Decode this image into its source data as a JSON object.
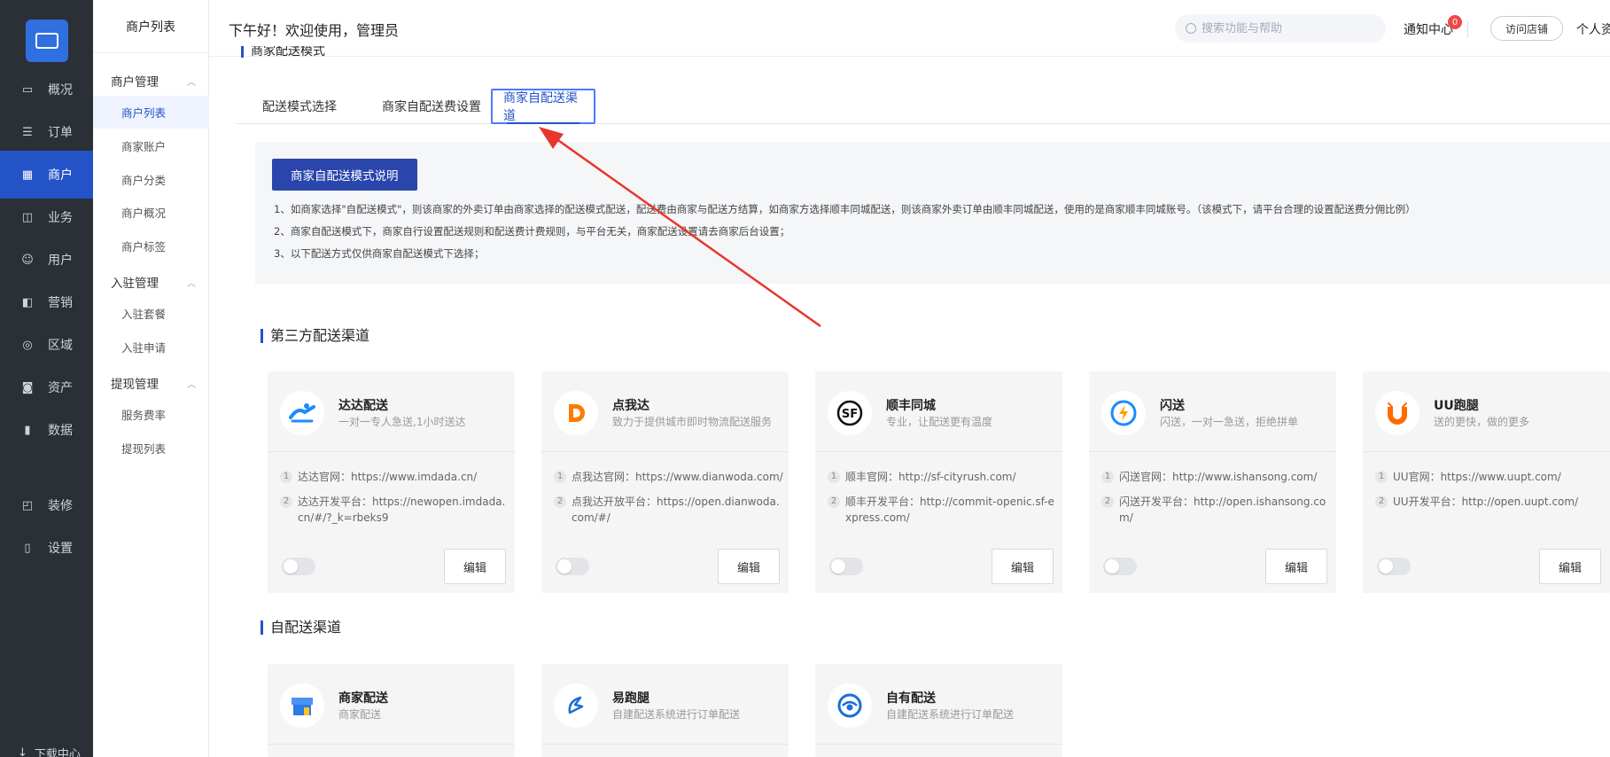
{
  "nav": {
    "items": [
      {
        "label": "概况",
        "icon": "dashboard-icon"
      },
      {
        "label": "订单",
        "icon": "order-icon"
      },
      {
        "label": "商户",
        "icon": "merchant-icon"
      },
      {
        "label": "业务",
        "icon": "business-icon"
      },
      {
        "label": "用户",
        "icon": "user-icon"
      },
      {
        "label": "营销",
        "icon": "marketing-icon"
      },
      {
        "label": "区域",
        "icon": "region-icon"
      },
      {
        "label": "资产",
        "icon": "asset-icon"
      },
      {
        "label": "数据",
        "icon": "data-icon"
      },
      {
        "label": "装修",
        "icon": "decorate-icon"
      },
      {
        "label": "设置",
        "icon": "settings-icon"
      }
    ],
    "footer": "下载中心",
    "active_color": "#2353c6"
  },
  "subnav": {
    "title": "商户列表",
    "groups": [
      {
        "label": "商户管理",
        "items": [
          "商户列表",
          "商家账户",
          "商户分类",
          "商户概况",
          "商户标签"
        ]
      },
      {
        "label": "入驻管理",
        "items": [
          "入驻套餐",
          "入驻申请"
        ]
      },
      {
        "label": "提现管理",
        "items": [
          "服务费率",
          "提现列表"
        ]
      }
    ]
  },
  "header": {
    "greeting": "下午好！欢迎使用，管理员",
    "search_placeholder": "搜索功能与帮助",
    "notice": "通知中心",
    "notice_count": "0",
    "visit_store": "访问店铺",
    "personal": "个人资"
  },
  "page": {
    "crumb": "商家配送模式",
    "tabs": [
      "配送模式选择",
      "商家自配送费设置",
      "商家自配送渠道"
    ],
    "info": {
      "button": "商家自配送模式说明",
      "lines": [
        "1、如商家选择\"自配送模式\"，则该商家的外卖订单由商家选择的配送模式配送，配送费由商家与配送方结算，如商家方选择顺丰同城配送，则该商家外卖订单由顺丰同城配送，使用的是商家顺丰同城账号。（该模式下，请平台合理的设置配送费分佣比例）",
        "2、商家自配送模式下，商家自行设置配送规则和配送费计费规则，与平台无关，商家配送设置请去商家后台设置；",
        "3、以下配送方式仅供商家自配送模式下选择；"
      ]
    },
    "third_party_title": "第三方配送渠道",
    "third_party": [
      {
        "name": "达达配送",
        "desc": "一对一专人急送,1小时送达",
        "icon": "dada-logo-icon",
        "rows": [
          "达达官网：https://www.imdada.cn/",
          "达达开发平台：https://newopen.imdada.cn/#/?_k=rbeks9"
        ],
        "edit": "编辑"
      },
      {
        "name": "点我达",
        "desc": "致力于提供城市即时物流配送服务",
        "icon": "dianwoda-logo-icon",
        "rows": [
          "点我达官网：https://www.dianwoda.com/",
          "点我达开放平台：https://open.dianwoda.com/#/"
        ],
        "edit": "编辑"
      },
      {
        "name": "顺丰同城",
        "desc": "专业，让配送更有温度",
        "icon": "sf-logo-icon",
        "rows": [
          "顺丰官网：http://sf-cityrush.com/",
          "顺丰开发平台：http://commit-openic.sf-express.com/"
        ],
        "edit": "编辑"
      },
      {
        "name": "闪送",
        "desc": "闪送，一对一急送，拒绝拼单",
        "icon": "shansong-logo-icon",
        "rows": [
          "闪送官网：http://www.ishansong.com/",
          "闪送开发平台：http://open.ishansong.com/"
        ],
        "edit": "编辑"
      },
      {
        "name": "UU跑腿",
        "desc": "送的更快，做的更多",
        "icon": "uu-logo-icon",
        "rows": [
          "UU官网：https://www.uupt.com/",
          "UU开发平台：http://open.uupt.com/"
        ],
        "edit": "编辑"
      }
    ],
    "self_title": "自配送渠道",
    "self": [
      {
        "name": "商家配送",
        "desc": "商家配送",
        "icon": "shop-logo-icon"
      },
      {
        "name": "易跑腿",
        "desc": "自建配送系统进行订单配送",
        "icon": "yipaotui-logo-icon"
      },
      {
        "name": "自有配送",
        "desc": "自建配送系统进行订单配送",
        "icon": "own-delivery-logo-icon"
      }
    ],
    "annotation_color": "#e8362c"
  }
}
